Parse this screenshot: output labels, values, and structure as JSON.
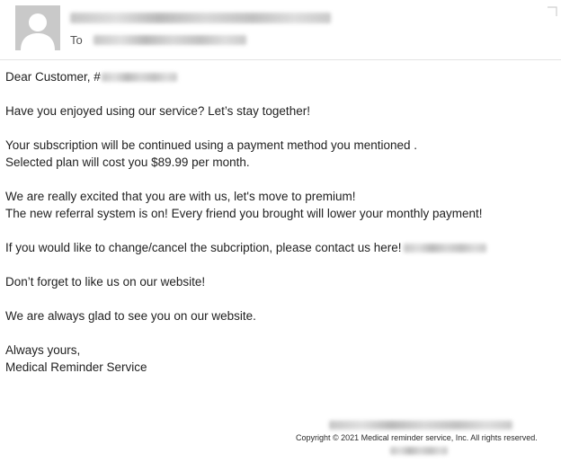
{
  "header": {
    "to_label": "To"
  },
  "body": {
    "greeting": "Dear Customer, #",
    "line1": "Have you enjoyed using our service? Let’s stay together!",
    "line2": "Your subscription will be continued using a payment method you mentioned .",
    "line3": "Selected plan will cost you $89.99 per month.",
    "line4": "We are really excited that you are with us, let's move to premium!",
    "line5": "The new referral system is on! Every friend you brought will lower your monthly payment!",
    "line6": "If you would like to change/cancel the subcription, please contact us here!",
    "line7": "Don’t forget to like us on our website!",
    "line8": "We are always glad to see you on our website.",
    "signoff": "Always yours,",
    "signature": "Medical Reminder Service"
  },
  "footer": {
    "copyright": "Copyright © 2021 Medical reminder service, Inc. All rights reserved."
  },
  "icons": {
    "avatar": "person-silhouette-icon"
  }
}
